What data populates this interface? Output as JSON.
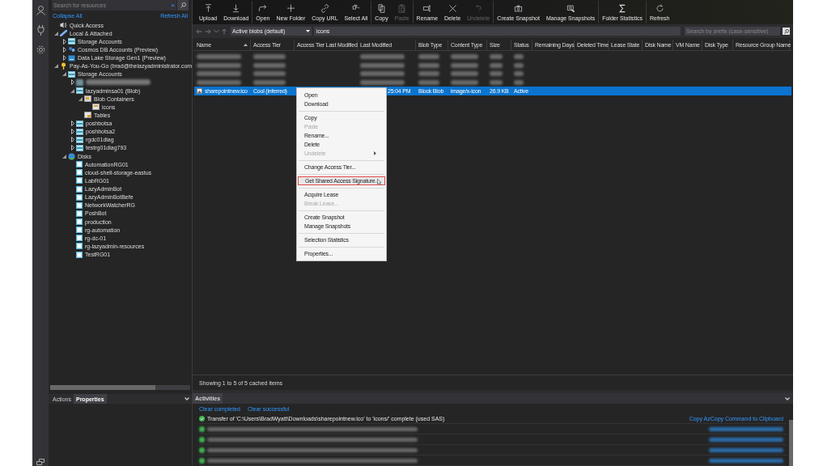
{
  "sidebar": {
    "search": {
      "placeholder": "Search for resources",
      "clear_glyph": "×"
    },
    "collapse_all": "Collapse All",
    "refresh_all": "Refresh All",
    "tree": [
      {
        "kind": "quick-access",
        "label": "Quick Access"
      },
      {
        "kind": "attached",
        "label": "Local & Attached",
        "expanded": true,
        "children": [
          {
            "kind": "storage-account",
            "label": "Storage Accounts",
            "expanded": false
          },
          {
            "kind": "cosmos",
            "label": "Cosmos DB Accounts (Preview)",
            "expanded": false
          },
          {
            "kind": "datalake",
            "label": "Data Lake Storage Gen1 (Preview)",
            "expanded": false
          }
        ]
      },
      {
        "kind": "subscription",
        "label": "Pay-As-You-Go (brad@thelazyadministrator.com",
        "expanded": true,
        "children": [
          {
            "kind": "storage-account",
            "label": "Storage Accounts",
            "expanded": true,
            "children": [
              {
                "kind": "redacted",
                "expanded": false
              },
              {
                "kind": "storage-account",
                "label": "lazyadminsa01 (Blob)",
                "expanded": true,
                "children": [
                  {
                    "kind": "containers",
                    "label": "Blob Containers",
                    "expanded": true,
                    "children": [
                      {
                        "kind": "container",
                        "label": "icons"
                      }
                    ]
                  },
                  {
                    "kind": "tables",
                    "label": "Tables"
                  }
                ]
              },
              {
                "kind": "storage-account",
                "label": "poshbotsa",
                "expanded": false
              },
              {
                "kind": "storage-account",
                "label": "poshbotsa2",
                "expanded": false
              },
              {
                "kind": "storage-account",
                "label": "rgdc01diag",
                "expanded": false
              },
              {
                "kind": "storage-account",
                "label": "testrg01diag793",
                "expanded": false
              }
            ]
          },
          {
            "kind": "disks",
            "label": "Disks",
            "expanded": true,
            "children": [
              {
                "kind": "disk",
                "label": "AutomationRG01"
              },
              {
                "kind": "disk",
                "label": "cloud-shell-storage-eastus"
              },
              {
                "kind": "disk",
                "label": "LabRG01"
              },
              {
                "kind": "disk",
                "label": "LazyAdminBot"
              },
              {
                "kind": "disk",
                "label": "LazyAdminBotBefe"
              },
              {
                "kind": "disk",
                "label": "NetworkWatcherRG"
              },
              {
                "kind": "disk",
                "label": "PoshBot"
              },
              {
                "kind": "disk",
                "label": "production"
              },
              {
                "kind": "disk",
                "label": "rg-automation"
              },
              {
                "kind": "disk",
                "label": "rg-dc-01"
              },
              {
                "kind": "disk",
                "label": "rg-lazyadmin-resources"
              },
              {
                "kind": "disk",
                "label": "TestRG01"
              }
            ]
          }
        ]
      }
    ],
    "bottom_tabs": [
      {
        "label": "Actions",
        "selected": false
      },
      {
        "label": "Properties",
        "selected": true
      }
    ]
  },
  "toolbar": [
    [
      {
        "label": "Upload",
        "disabled": false
      },
      {
        "label": "Download",
        "disabled": false
      }
    ],
    [
      {
        "label": "Open",
        "disabled": false
      },
      {
        "label": "New Folder",
        "disabled": false
      },
      {
        "label": "Copy URL",
        "disabled": false
      },
      {
        "label": "Select All",
        "disabled": false
      }
    ],
    [
      {
        "label": "Copy",
        "disabled": false
      },
      {
        "label": "Paste",
        "disabled": true
      }
    ],
    [
      {
        "label": "Rename",
        "disabled": false
      },
      {
        "label": "Delete",
        "disabled": false
      },
      {
        "label": "Undelete",
        "disabled": true
      }
    ],
    [
      {
        "label": "Create Snapshot",
        "disabled": false
      },
      {
        "label": "Manage Snapshots",
        "disabled": false
      }
    ],
    [
      {
        "label": "Folder Statistics",
        "disabled": false
      }
    ],
    [
      {
        "label": "Refresh",
        "disabled": false
      }
    ]
  ],
  "path_bar": {
    "view": "Active blobs (default)",
    "path": "icons",
    "search_placeholder": "Search by prefix (case-sensitive)"
  },
  "table": {
    "columns": [
      "Name",
      "Access Tier",
      "Access Tier Last Modified",
      "Last Modified",
      "Blob Type",
      "Content Type",
      "Size",
      "Status",
      "Remaining Days",
      "Deleted Time",
      "Lease State",
      "Disk Name",
      "VM Name",
      "Disk Type",
      "Resource Group Name"
    ],
    "rows": [
      {
        "kind": "redacted",
        "selected": false
      },
      {
        "kind": "redacted",
        "selected": false
      },
      {
        "kind": "redacted",
        "selected": false
      },
      {
        "kind": "redacted",
        "selected": false
      },
      {
        "kind": "blob",
        "selected": true,
        "cells": [
          "sharepointnew.ico",
          "Cool (inferred)",
          "",
          "25:04 PM",
          "Block Blob",
          "image/x-icon",
          "26.9 KB",
          "Active"
        ]
      }
    ]
  },
  "status": "Showing 1 to 5 of 5 cached items",
  "activities": {
    "title": "Activities",
    "links": [
      "Clear completed",
      "Clear successful"
    ],
    "entries": [
      {
        "kind": "transfer",
        "text": "Transfer of 'C:\\Users\\BradWyatt\\Downloads\\sharepointnew.ico' to 'icons/' complete (used SAS)",
        "action": "Copy AzCopy Command to Clipboard"
      },
      {
        "kind": "redacted"
      },
      {
        "kind": "redacted"
      },
      {
        "kind": "redacted"
      },
      {
        "kind": "redacted"
      }
    ]
  },
  "context_menu": [
    [
      {
        "label": "Open",
        "disabled": false
      },
      {
        "label": "Download",
        "disabled": false
      }
    ],
    [
      {
        "label": "Copy",
        "disabled": false
      },
      {
        "label": "Paste",
        "disabled": true
      },
      {
        "label": "Rename...",
        "disabled": false
      },
      {
        "label": "Delete",
        "disabled": false
      },
      {
        "label": "Undelete",
        "disabled": true,
        "submenu": true
      }
    ],
    [
      {
        "label": "Change Access Tier...",
        "disabled": false
      }
    ],
    [
      {
        "label": "Get Shared Access Signature...",
        "disabled": false,
        "highlighted": true
      }
    ],
    [
      {
        "label": "Acquire Lease",
        "disabled": false
      },
      {
        "label": "Break Lease...",
        "disabled": true
      }
    ],
    [
      {
        "label": "Create Snapshot",
        "disabled": false
      },
      {
        "label": "Manage Snapshots",
        "disabled": false
      }
    ],
    [
      {
        "label": "Selection Statistics",
        "disabled": false
      }
    ],
    [
      {
        "label": "Properties...",
        "disabled": false
      }
    ]
  ]
}
